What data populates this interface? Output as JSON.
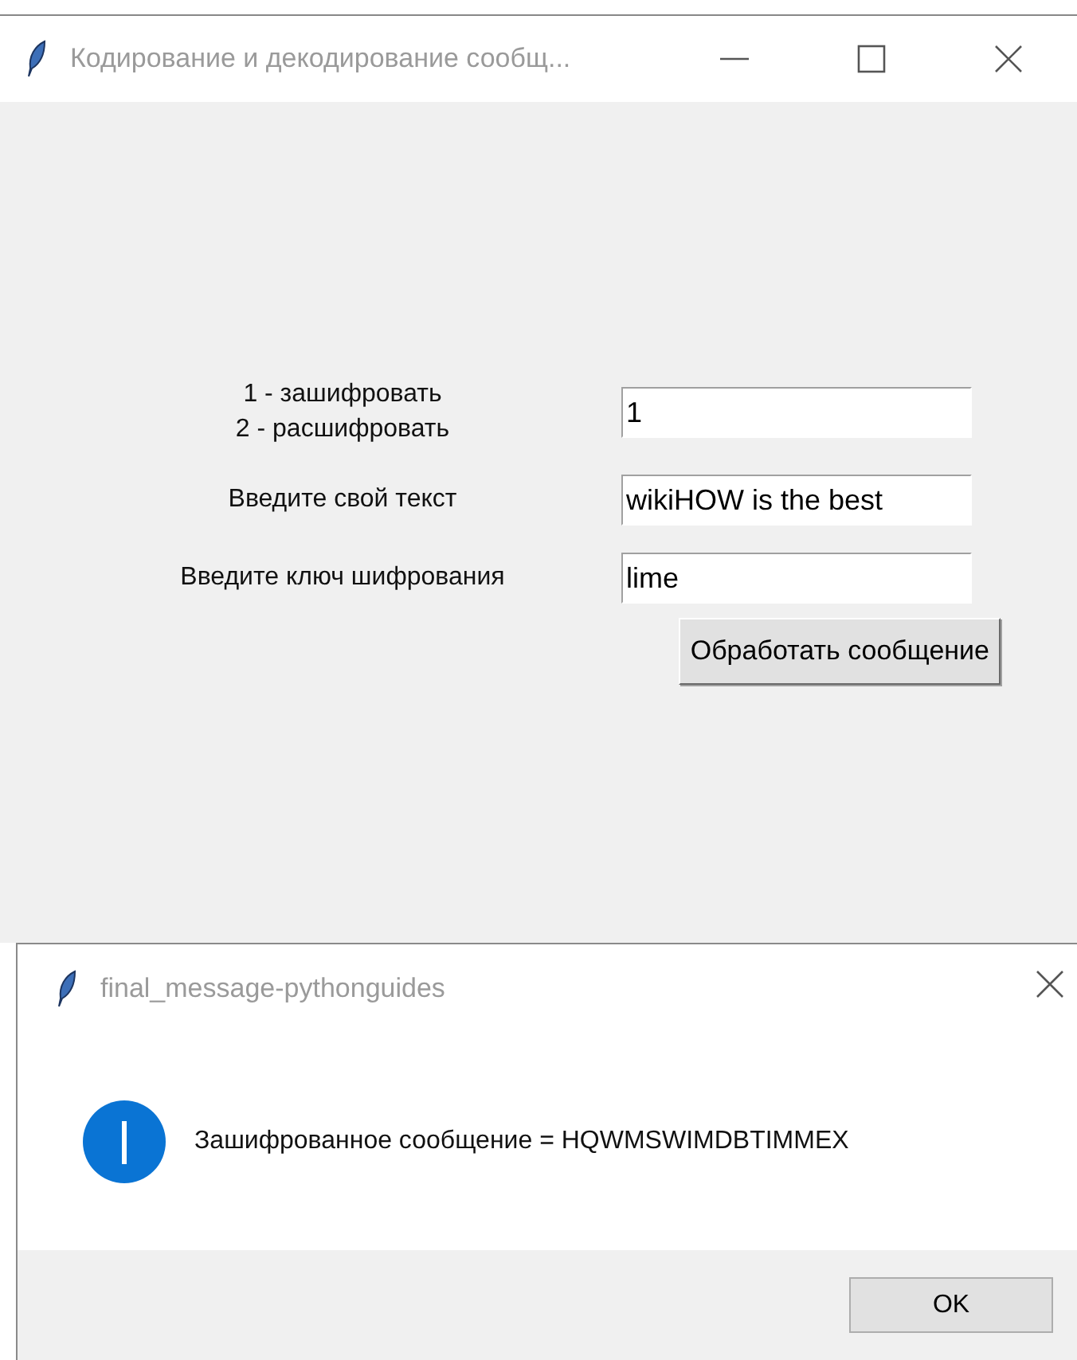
{
  "main_window": {
    "title": "Кодирование и декодирование сообщ...",
    "form": {
      "rows": [
        {
          "label": "1 - зашифровать\n2 - расшифровать",
          "value": "1"
        },
        {
          "label": "Введите свой текст",
          "value": "wikiHOW is the best"
        },
        {
          "label": "Введите ключ шифрования",
          "value": "lime"
        }
      ],
      "button": "Обработать сообщение"
    }
  },
  "dialog": {
    "title": "final_message-pythonguides",
    "message": "Зашифрованное сообщение = HQWMSWIMDBTIMMEX",
    "buttons": [
      "OK"
    ]
  }
}
